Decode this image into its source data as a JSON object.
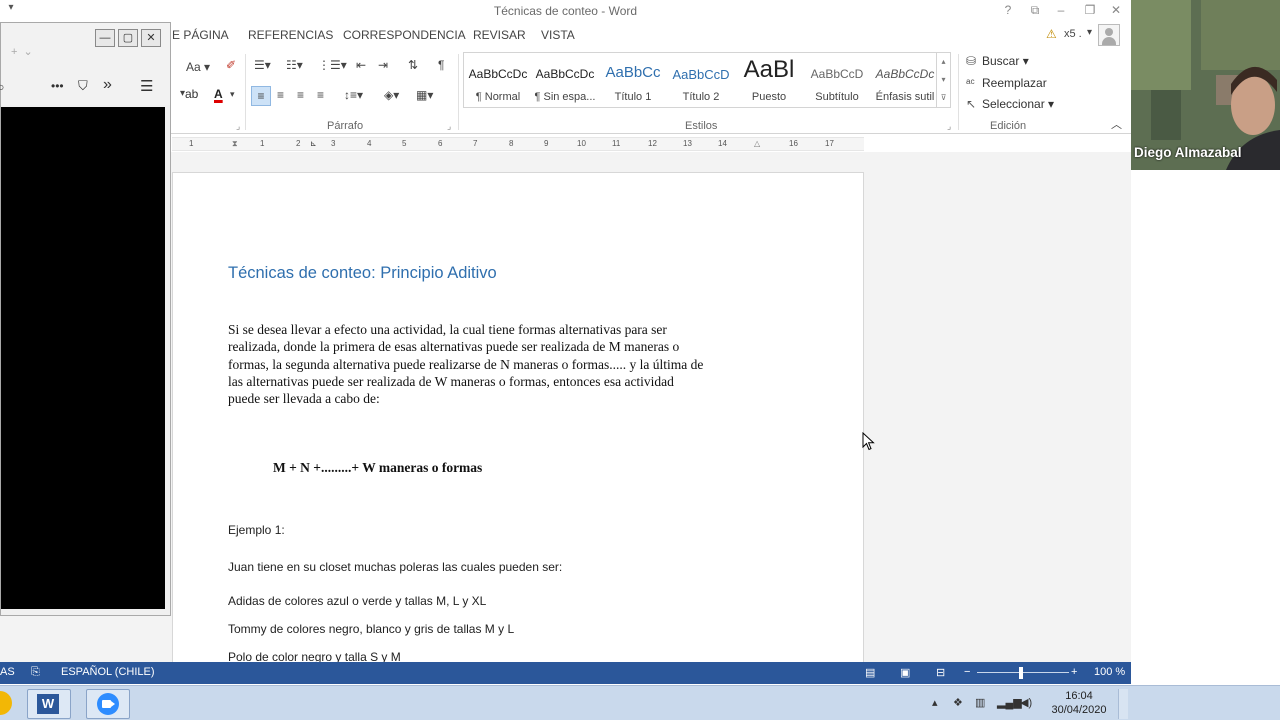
{
  "window": {
    "title": "Técnicas de conteo - Word"
  },
  "tabs": [
    "E PÁGINA",
    "REFERENCIAS",
    "CORRESPONDENCIA",
    "REVISAR",
    "VISTA"
  ],
  "account": {
    "user_label": "x5 ."
  },
  "ribbon": {
    "groups": {
      "paragraph": "Párrafo",
      "styles": "Estilos",
      "editing": "Edición"
    },
    "font_size_control": "Aa",
    "styles": [
      {
        "preview": "AaBbCcDc",
        "name": "¶ Normal"
      },
      {
        "preview": "AaBbCcDc",
        "name": "¶ Sin espa..."
      },
      {
        "preview": "AaBbCc",
        "name": "Título 1"
      },
      {
        "preview": "AaBbCcD",
        "name": "Título 2"
      },
      {
        "preview": "AaBl",
        "name": "Puesto"
      },
      {
        "preview": "AaBbCcD",
        "name": "Subtítulo"
      },
      {
        "preview": "AaBbCcDc",
        "name": "Énfasis sutil"
      }
    ],
    "editing": {
      "find": "Buscar",
      "replace": "Reemplazar",
      "select": "Seleccionar"
    }
  },
  "ruler": {
    "labels": [
      "1",
      "1",
      "2",
      "3",
      "4",
      "5",
      "6",
      "7",
      "8",
      "9",
      "10",
      "11",
      "12",
      "13",
      "14",
      "16",
      "17"
    ]
  },
  "document": {
    "heading": "Técnicas de conteo: Principio Aditivo",
    "paragraph_lines": [
      "Si se desea llevar a efecto una actividad, la cual tiene formas alternativas para ser",
      "realizada, donde la primera de esas alternativas puede ser realizada de M maneras o",
      "formas, la segunda alternativa puede realizarse de N maneras o formas..... y la última de",
      "las alternativas puede ser realizada de W maneras o formas, entonces esa actividad",
      "puede ser llevada  a cabo de:"
    ],
    "formula": "M + N +.........+ W  maneras o formas",
    "example_title": "Ejemplo 1:",
    "example_intro": "Juan tiene en su closet muchas poleras las cuales pueden ser:",
    "items": [
      "Adidas de colores azul o verde y tallas M, L y XL",
      "Tommy de colores negro, blanco  y gris de tallas M y L",
      "Polo de color negro y talla S y M"
    ]
  },
  "statusbar": {
    "left_text": "AS",
    "language": "ESPAÑOL (CHILE)",
    "zoom": "100 %"
  },
  "webcam": {
    "participant_name": "Diego Almazabal"
  },
  "taskbar": {
    "time": "16:04",
    "date": "30/04/2020"
  },
  "colors": {
    "word_blue": "#2b579a",
    "heading_blue": "#2f6fae",
    "taskbar": "#c9d9ec"
  }
}
